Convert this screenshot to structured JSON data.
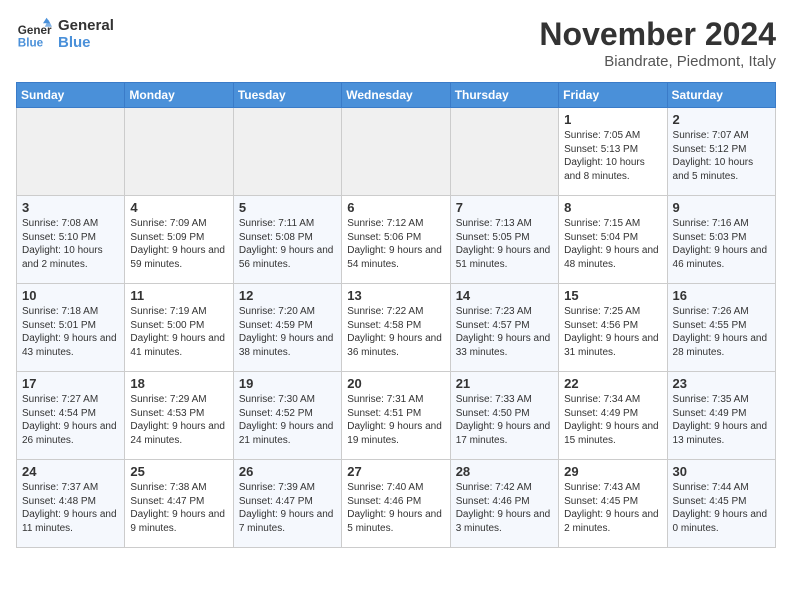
{
  "logo": {
    "line1": "General",
    "line2": "Blue"
  },
  "title": "November 2024",
  "location": "Biandrate, Piedmont, Italy",
  "weekdays": [
    "Sunday",
    "Monday",
    "Tuesday",
    "Wednesday",
    "Thursday",
    "Friday",
    "Saturday"
  ],
  "weeks": [
    [
      {
        "day": "",
        "info": ""
      },
      {
        "day": "",
        "info": ""
      },
      {
        "day": "",
        "info": ""
      },
      {
        "day": "",
        "info": ""
      },
      {
        "day": "",
        "info": ""
      },
      {
        "day": "1",
        "info": "Sunrise: 7:05 AM\nSunset: 5:13 PM\nDaylight: 10 hours and 8 minutes."
      },
      {
        "day": "2",
        "info": "Sunrise: 7:07 AM\nSunset: 5:12 PM\nDaylight: 10 hours and 5 minutes."
      }
    ],
    [
      {
        "day": "3",
        "info": "Sunrise: 7:08 AM\nSunset: 5:10 PM\nDaylight: 10 hours and 2 minutes."
      },
      {
        "day": "4",
        "info": "Sunrise: 7:09 AM\nSunset: 5:09 PM\nDaylight: 9 hours and 59 minutes."
      },
      {
        "day": "5",
        "info": "Sunrise: 7:11 AM\nSunset: 5:08 PM\nDaylight: 9 hours and 56 minutes."
      },
      {
        "day": "6",
        "info": "Sunrise: 7:12 AM\nSunset: 5:06 PM\nDaylight: 9 hours and 54 minutes."
      },
      {
        "day": "7",
        "info": "Sunrise: 7:13 AM\nSunset: 5:05 PM\nDaylight: 9 hours and 51 minutes."
      },
      {
        "day": "8",
        "info": "Sunrise: 7:15 AM\nSunset: 5:04 PM\nDaylight: 9 hours and 48 minutes."
      },
      {
        "day": "9",
        "info": "Sunrise: 7:16 AM\nSunset: 5:03 PM\nDaylight: 9 hours and 46 minutes."
      }
    ],
    [
      {
        "day": "10",
        "info": "Sunrise: 7:18 AM\nSunset: 5:01 PM\nDaylight: 9 hours and 43 minutes."
      },
      {
        "day": "11",
        "info": "Sunrise: 7:19 AM\nSunset: 5:00 PM\nDaylight: 9 hours and 41 minutes."
      },
      {
        "day": "12",
        "info": "Sunrise: 7:20 AM\nSunset: 4:59 PM\nDaylight: 9 hours and 38 minutes."
      },
      {
        "day": "13",
        "info": "Sunrise: 7:22 AM\nSunset: 4:58 PM\nDaylight: 9 hours and 36 minutes."
      },
      {
        "day": "14",
        "info": "Sunrise: 7:23 AM\nSunset: 4:57 PM\nDaylight: 9 hours and 33 minutes."
      },
      {
        "day": "15",
        "info": "Sunrise: 7:25 AM\nSunset: 4:56 PM\nDaylight: 9 hours and 31 minutes."
      },
      {
        "day": "16",
        "info": "Sunrise: 7:26 AM\nSunset: 4:55 PM\nDaylight: 9 hours and 28 minutes."
      }
    ],
    [
      {
        "day": "17",
        "info": "Sunrise: 7:27 AM\nSunset: 4:54 PM\nDaylight: 9 hours and 26 minutes."
      },
      {
        "day": "18",
        "info": "Sunrise: 7:29 AM\nSunset: 4:53 PM\nDaylight: 9 hours and 24 minutes."
      },
      {
        "day": "19",
        "info": "Sunrise: 7:30 AM\nSunset: 4:52 PM\nDaylight: 9 hours and 21 minutes."
      },
      {
        "day": "20",
        "info": "Sunrise: 7:31 AM\nSunset: 4:51 PM\nDaylight: 9 hours and 19 minutes."
      },
      {
        "day": "21",
        "info": "Sunrise: 7:33 AM\nSunset: 4:50 PM\nDaylight: 9 hours and 17 minutes."
      },
      {
        "day": "22",
        "info": "Sunrise: 7:34 AM\nSunset: 4:49 PM\nDaylight: 9 hours and 15 minutes."
      },
      {
        "day": "23",
        "info": "Sunrise: 7:35 AM\nSunset: 4:49 PM\nDaylight: 9 hours and 13 minutes."
      }
    ],
    [
      {
        "day": "24",
        "info": "Sunrise: 7:37 AM\nSunset: 4:48 PM\nDaylight: 9 hours and 11 minutes."
      },
      {
        "day": "25",
        "info": "Sunrise: 7:38 AM\nSunset: 4:47 PM\nDaylight: 9 hours and 9 minutes."
      },
      {
        "day": "26",
        "info": "Sunrise: 7:39 AM\nSunset: 4:47 PM\nDaylight: 9 hours and 7 minutes."
      },
      {
        "day": "27",
        "info": "Sunrise: 7:40 AM\nSunset: 4:46 PM\nDaylight: 9 hours and 5 minutes."
      },
      {
        "day": "28",
        "info": "Sunrise: 7:42 AM\nSunset: 4:46 PM\nDaylight: 9 hours and 3 minutes."
      },
      {
        "day": "29",
        "info": "Sunrise: 7:43 AM\nSunset: 4:45 PM\nDaylight: 9 hours and 2 minutes."
      },
      {
        "day": "30",
        "info": "Sunrise: 7:44 AM\nSunset: 4:45 PM\nDaylight: 9 hours and 0 minutes."
      }
    ]
  ]
}
